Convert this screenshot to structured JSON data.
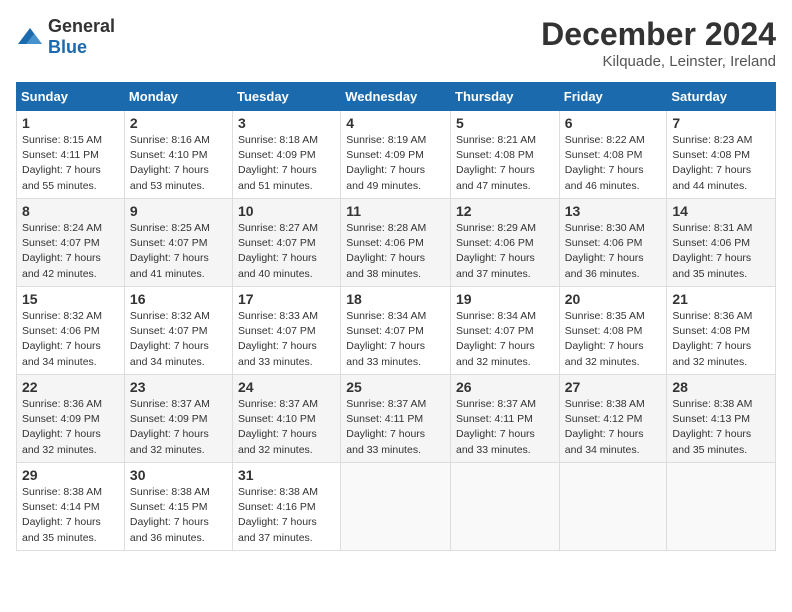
{
  "header": {
    "logo_general": "General",
    "logo_blue": "Blue",
    "month_title": "December 2024",
    "location": "Kilquade, Leinster, Ireland"
  },
  "weekdays": [
    "Sunday",
    "Monday",
    "Tuesday",
    "Wednesday",
    "Thursday",
    "Friday",
    "Saturday"
  ],
  "weeks": [
    [
      {
        "day": "1",
        "sunrise": "8:15 AM",
        "sunset": "4:11 PM",
        "daylight": "7 hours and 55 minutes."
      },
      {
        "day": "2",
        "sunrise": "8:16 AM",
        "sunset": "4:10 PM",
        "daylight": "7 hours and 53 minutes."
      },
      {
        "day": "3",
        "sunrise": "8:18 AM",
        "sunset": "4:09 PM",
        "daylight": "7 hours and 51 minutes."
      },
      {
        "day": "4",
        "sunrise": "8:19 AM",
        "sunset": "4:09 PM",
        "daylight": "7 hours and 49 minutes."
      },
      {
        "day": "5",
        "sunrise": "8:21 AM",
        "sunset": "4:08 PM",
        "daylight": "7 hours and 47 minutes."
      },
      {
        "day": "6",
        "sunrise": "8:22 AM",
        "sunset": "4:08 PM",
        "daylight": "7 hours and 46 minutes."
      },
      {
        "day": "7",
        "sunrise": "8:23 AM",
        "sunset": "4:08 PM",
        "daylight": "7 hours and 44 minutes."
      }
    ],
    [
      {
        "day": "8",
        "sunrise": "8:24 AM",
        "sunset": "4:07 PM",
        "daylight": "7 hours and 42 minutes."
      },
      {
        "day": "9",
        "sunrise": "8:25 AM",
        "sunset": "4:07 PM",
        "daylight": "7 hours and 41 minutes."
      },
      {
        "day": "10",
        "sunrise": "8:27 AM",
        "sunset": "4:07 PM",
        "daylight": "7 hours and 40 minutes."
      },
      {
        "day": "11",
        "sunrise": "8:28 AM",
        "sunset": "4:06 PM",
        "daylight": "7 hours and 38 minutes."
      },
      {
        "day": "12",
        "sunrise": "8:29 AM",
        "sunset": "4:06 PM",
        "daylight": "7 hours and 37 minutes."
      },
      {
        "day": "13",
        "sunrise": "8:30 AM",
        "sunset": "4:06 PM",
        "daylight": "7 hours and 36 minutes."
      },
      {
        "day": "14",
        "sunrise": "8:31 AM",
        "sunset": "4:06 PM",
        "daylight": "7 hours and 35 minutes."
      }
    ],
    [
      {
        "day": "15",
        "sunrise": "8:32 AM",
        "sunset": "4:06 PM",
        "daylight": "7 hours and 34 minutes."
      },
      {
        "day": "16",
        "sunrise": "8:32 AM",
        "sunset": "4:07 PM",
        "daylight": "7 hours and 34 minutes."
      },
      {
        "day": "17",
        "sunrise": "8:33 AM",
        "sunset": "4:07 PM",
        "daylight": "7 hours and 33 minutes."
      },
      {
        "day": "18",
        "sunrise": "8:34 AM",
        "sunset": "4:07 PM",
        "daylight": "7 hours and 33 minutes."
      },
      {
        "day": "19",
        "sunrise": "8:34 AM",
        "sunset": "4:07 PM",
        "daylight": "7 hours and 32 minutes."
      },
      {
        "day": "20",
        "sunrise": "8:35 AM",
        "sunset": "4:08 PM",
        "daylight": "7 hours and 32 minutes."
      },
      {
        "day": "21",
        "sunrise": "8:36 AM",
        "sunset": "4:08 PM",
        "daylight": "7 hours and 32 minutes."
      }
    ],
    [
      {
        "day": "22",
        "sunrise": "8:36 AM",
        "sunset": "4:09 PM",
        "daylight": "7 hours and 32 minutes."
      },
      {
        "day": "23",
        "sunrise": "8:37 AM",
        "sunset": "4:09 PM",
        "daylight": "7 hours and 32 minutes."
      },
      {
        "day": "24",
        "sunrise": "8:37 AM",
        "sunset": "4:10 PM",
        "daylight": "7 hours and 32 minutes."
      },
      {
        "day": "25",
        "sunrise": "8:37 AM",
        "sunset": "4:11 PM",
        "daylight": "7 hours and 33 minutes."
      },
      {
        "day": "26",
        "sunrise": "8:37 AM",
        "sunset": "4:11 PM",
        "daylight": "7 hours and 33 minutes."
      },
      {
        "day": "27",
        "sunrise": "8:38 AM",
        "sunset": "4:12 PM",
        "daylight": "7 hours and 34 minutes."
      },
      {
        "day": "28",
        "sunrise": "8:38 AM",
        "sunset": "4:13 PM",
        "daylight": "7 hours and 35 minutes."
      }
    ],
    [
      {
        "day": "29",
        "sunrise": "8:38 AM",
        "sunset": "4:14 PM",
        "daylight": "7 hours and 35 minutes."
      },
      {
        "day": "30",
        "sunrise": "8:38 AM",
        "sunset": "4:15 PM",
        "daylight": "7 hours and 36 minutes."
      },
      {
        "day": "31",
        "sunrise": "8:38 AM",
        "sunset": "4:16 PM",
        "daylight": "7 hours and 37 minutes."
      },
      null,
      null,
      null,
      null
    ]
  ]
}
